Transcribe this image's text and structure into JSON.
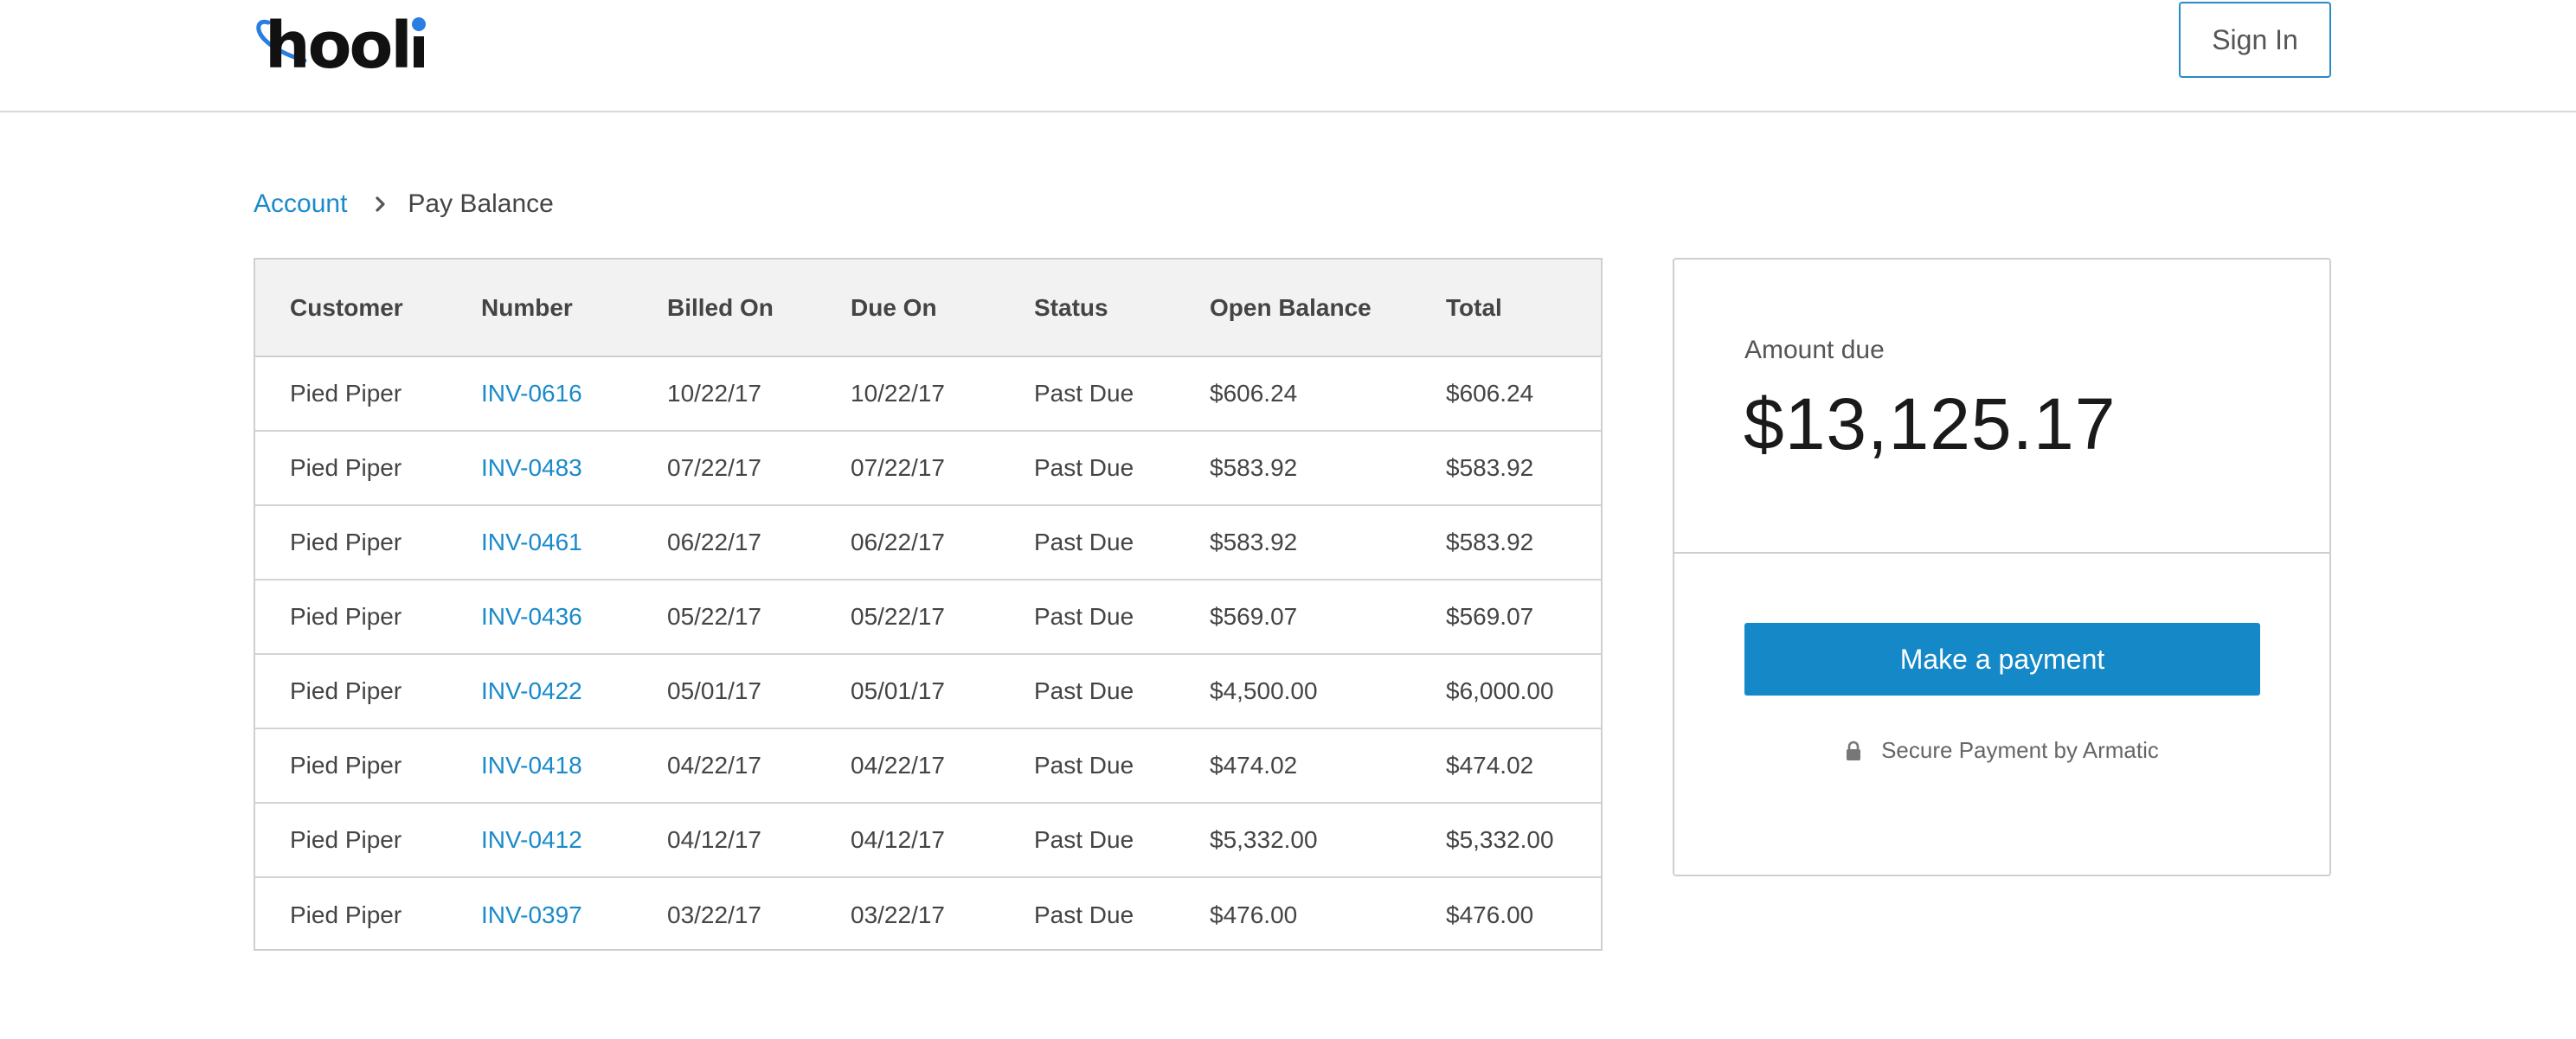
{
  "brand": {
    "logo_text": "hooli",
    "accent_color": "#2a7de1"
  },
  "header": {
    "signin_label": "Sign In"
  },
  "breadcrumb": {
    "parent": "Account",
    "separator_icon": "chevron-right-icon",
    "current": "Pay Balance"
  },
  "table": {
    "headers": [
      "Customer",
      "Number",
      "Billed On",
      "Due On",
      "Status",
      "Open Balance",
      "Total"
    ],
    "rows": [
      [
        "Pied Piper",
        "INV-0616",
        "10/22/17",
        "10/22/17",
        "Past Due",
        "$606.24",
        "$606.24"
      ],
      [
        "Pied Piper",
        "INV-0483",
        "07/22/17",
        "07/22/17",
        "Past Due",
        "$583.92",
        "$583.92"
      ],
      [
        "Pied Piper",
        "INV-0461",
        "06/22/17",
        "06/22/17",
        "Past Due",
        "$583.92",
        "$583.92"
      ],
      [
        "Pied Piper",
        "INV-0436",
        "05/22/17",
        "05/22/17",
        "Past Due",
        "$569.07",
        "$569.07"
      ],
      [
        "Pied Piper",
        "INV-0422",
        "05/01/17",
        "05/01/17",
        "Past Due",
        "$4,500.00",
        "$6,000.00"
      ],
      [
        "Pied Piper",
        "INV-0418",
        "04/22/17",
        "04/22/17",
        "Past Due",
        "$474.02",
        "$474.02"
      ],
      [
        "Pied Piper",
        "INV-0412",
        "04/12/17",
        "04/12/17",
        "Past Due",
        "$5,332.00",
        "$5,332.00"
      ],
      [
        "Pied Piper",
        "INV-0397",
        "03/22/17",
        "03/22/17",
        "Past Due",
        "$476.00",
        "$476.00"
      ]
    ]
  },
  "summary": {
    "amount_label": "Amount due",
    "amount_value": "$13,125.17",
    "pay_button_label": "Make a payment",
    "pay_button_color": "#1589c8",
    "secure_icon": "lock-icon",
    "secure_text": "Secure Payment by Armatic"
  }
}
